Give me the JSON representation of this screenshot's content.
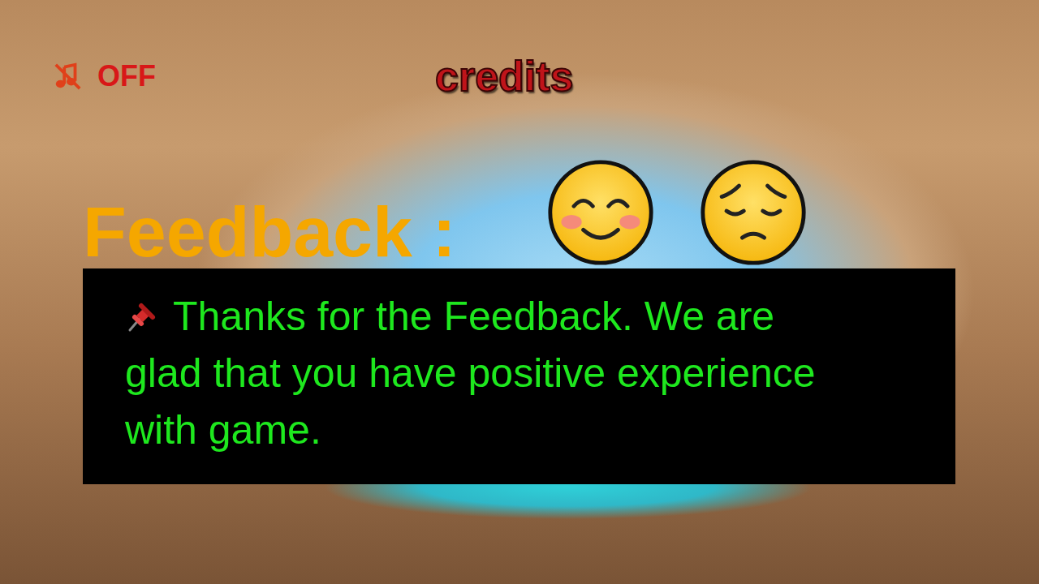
{
  "music": {
    "label": "OFF",
    "on": false
  },
  "credits": {
    "label": "credits"
  },
  "feedback": {
    "title": "Feedback :",
    "buttons": [
      {
        "kind": "happy"
      },
      {
        "kind": "sad"
      }
    ]
  },
  "message": {
    "text": "Thanks for the Feedback. We are glad that you have positive experience with game."
  }
}
